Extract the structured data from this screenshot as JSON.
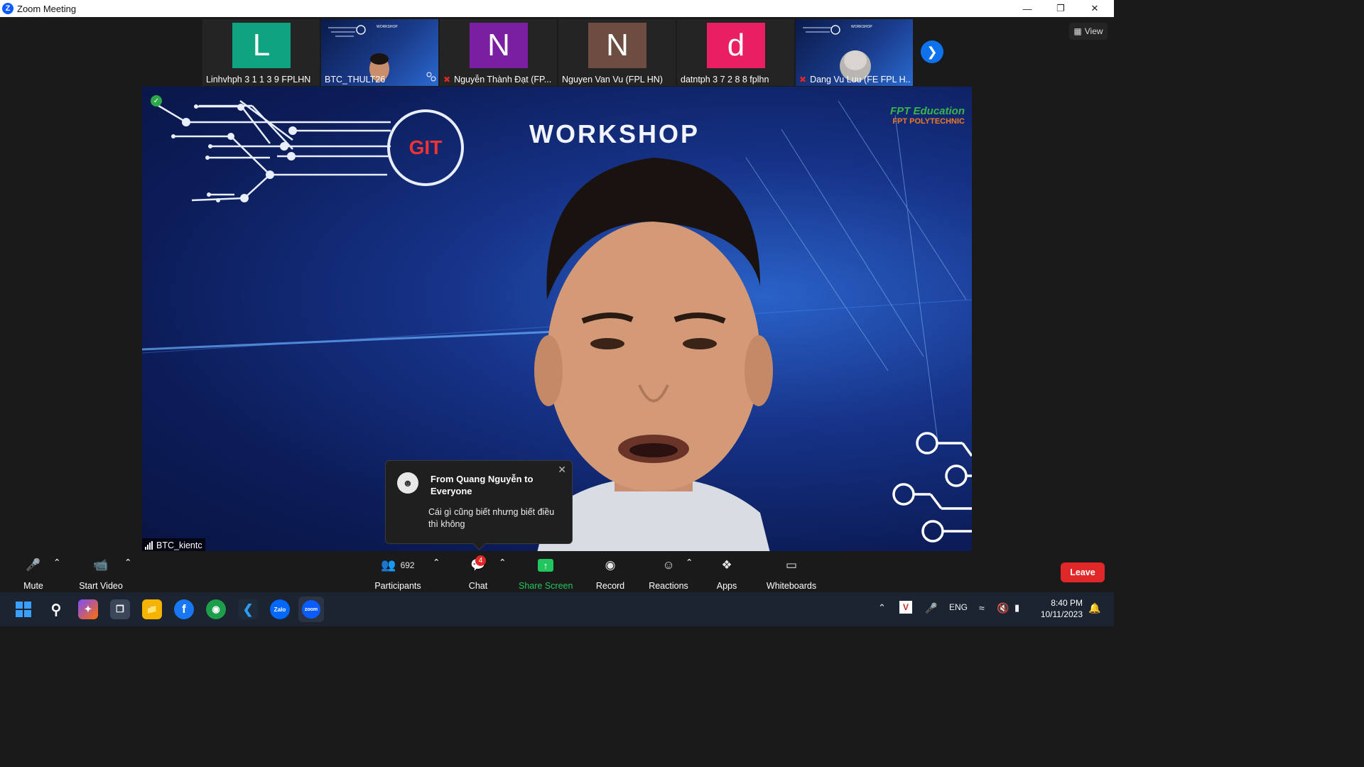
{
  "window": {
    "title": "Zoom Meeting"
  },
  "thumbnails": [
    {
      "name": "Linhvhph 3 1 1 3 9 FPLHN",
      "initial": "L",
      "color": "#10a37f",
      "muted": false,
      "video": false
    },
    {
      "name": "BTC_THULT26",
      "initial": "",
      "color": "",
      "muted": false,
      "video": true
    },
    {
      "name": "Nguyễn Thành Đạt (FP...",
      "initial": "N",
      "color": "#7b1fa2",
      "muted": true,
      "video": false
    },
    {
      "name": "Nguyen Van Vu (FPL HN)",
      "initial": "N",
      "color": "#6d4c41",
      "muted": false,
      "video": false
    },
    {
      "name": "datntph 3 7 2 8 8 fplhn",
      "initial": "d",
      "color": "#e91e63",
      "muted": false,
      "video": false
    },
    {
      "name": "Dang Vu Luu (FE FPL H...",
      "initial": "",
      "color": "",
      "muted": true,
      "video": true
    }
  ],
  "view_button": {
    "label": "View"
  },
  "main_video": {
    "speaker_name": "BTC_kientc",
    "background": {
      "badge": "GIT",
      "title": "WORKSHOP",
      "brand_line1": "FPT Education",
      "brand_line2": "FPT POLYTECHNIC"
    }
  },
  "chat_toast": {
    "header": "From Quang Nguyễn to Everyone",
    "message": "Cái gì cũng biết nhưng biết điều thì không"
  },
  "toolbar": {
    "mute": "Mute",
    "start_video": "Start Video",
    "participants_count": "692",
    "participants": "Participants",
    "chat": "Chat",
    "chat_badge": "4",
    "share_screen": "Share Screen",
    "record": "Record",
    "reactions": "Reactions",
    "apps": "Apps",
    "whiteboards": "Whiteboards",
    "leave": "Leave"
  },
  "taskbar": {
    "zalo_label": "Zalo",
    "zoom_label": "zoom",
    "language": "ENG",
    "time": "8:40 PM",
    "date": "10/11/2023"
  },
  "colors": {
    "accent_blue": "#0e72ed",
    "share_green": "#22c55e",
    "leave_red": "#e02828"
  }
}
